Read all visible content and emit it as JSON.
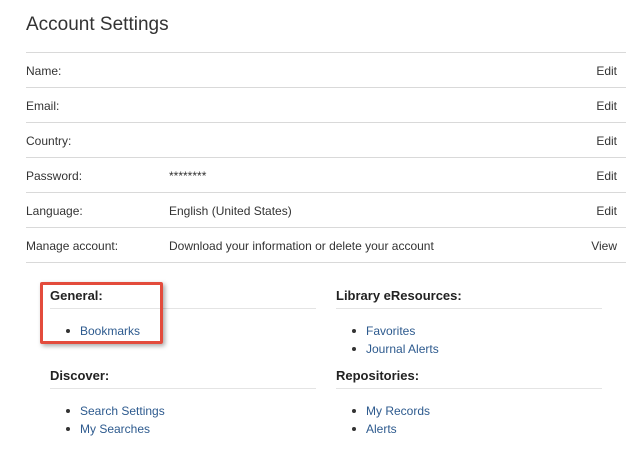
{
  "page": {
    "title": "Account Settings"
  },
  "settings_rows": [
    {
      "label": "Name:",
      "value": "",
      "action": "Edit"
    },
    {
      "label": "Email:",
      "value": "",
      "action": "Edit"
    },
    {
      "label": "Country:",
      "value": "",
      "action": "Edit"
    },
    {
      "label": "Password:",
      "value": "********",
      "action": "Edit"
    },
    {
      "label": "Language:",
      "value": "English (United States)",
      "action": "Edit"
    },
    {
      "label": "Manage account:",
      "value": "Download your information or delete your account",
      "action": "View"
    }
  ],
  "sections": {
    "general": {
      "heading": "General:",
      "links": [
        "Bookmarks"
      ]
    },
    "library": {
      "heading": "Library eResources:",
      "links": [
        "Favorites",
        "Journal Alerts"
      ]
    },
    "discover": {
      "heading": "Discover:",
      "links": [
        "Search Settings",
        "My Searches"
      ]
    },
    "repositories": {
      "heading": "Repositories:",
      "links": [
        "My Records",
        "Alerts"
      ]
    }
  },
  "colors": {
    "link": "#2d5a8e",
    "highlight": "#e34b3c",
    "divider": "#d9d9d9"
  }
}
